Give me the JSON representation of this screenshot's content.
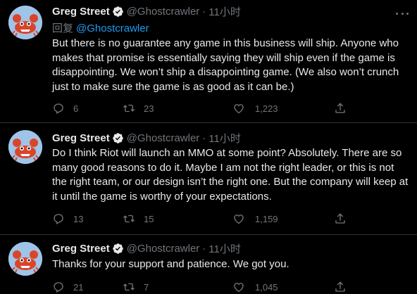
{
  "colors": {
    "background": "#000000",
    "text": "#e7e9ea",
    "muted": "#71767b",
    "link": "#1d9bf0",
    "divider": "#2f3336"
  },
  "tweets": [
    {
      "author_name": "Greg Street",
      "handle": "@Ghostcrawler",
      "separator": "·",
      "time": "11小时",
      "reply_prefix": "回复",
      "reply_to": "@Ghostcrawler",
      "text": "But there is no guarantee any game in this business will ship. Anyone who makes that promise is essentially saying they will ship even if the game is disappointing. We won’t ship a disappointing game. (We also won’t crunch just to make sure the game is as good as it can be.)",
      "replies": "6",
      "retweets": "23",
      "likes": "1,223",
      "icons": [
        "avatar-crab",
        "verified-badge-icon",
        "more-icon",
        "reply-icon",
        "retweet-icon",
        "like-icon",
        "share-icon"
      ]
    },
    {
      "author_name": "Greg Street",
      "handle": "@Ghostcrawler",
      "separator": "·",
      "time": "11小时",
      "text": "Do I think Riot will launch an MMO at some point? Absolutely. There are so many good reasons to do it. Maybe I am not the right leader, or this is not the right team, or our design isn’t the right one. But the company will keep at it until the game is worthy of your expectations.",
      "replies": "13",
      "retweets": "15",
      "likes": "1,159"
    },
    {
      "author_name": "Greg Street",
      "handle": "@Ghostcrawler",
      "separator": "·",
      "time": "11小时",
      "text": "Thanks for your support and patience. We got you.",
      "replies": "21",
      "retweets": "7",
      "likes": "1,045"
    }
  ]
}
